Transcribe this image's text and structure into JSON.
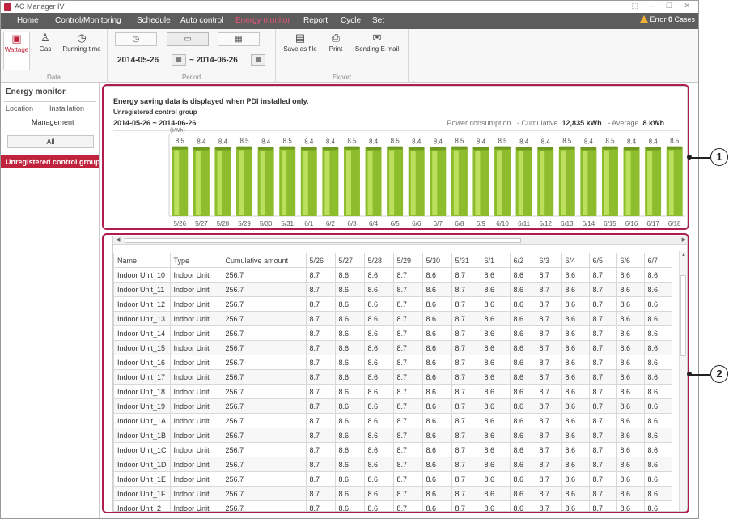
{
  "window": {
    "title": "AC Manager IV",
    "controls": "⬚ – ☐ ✕"
  },
  "menu": {
    "items": [
      "Home",
      "Control/Monitoring",
      "Schedule",
      "Auto control",
      "Energy monitor",
      "Report",
      "Cycle",
      "Set"
    ],
    "active": "Energy monitor",
    "error_prefix": "Error",
    "error_count": "0",
    "error_suffix": "Cases"
  },
  "ribbon": {
    "data_group": {
      "label": "Data",
      "buttons": [
        "Wattage",
        "Gas",
        "Running time"
      ]
    },
    "period_group": {
      "label": "Period",
      "start": "2014-05-26",
      "end": "~ 2014-06-26"
    },
    "export_group": {
      "label": "Export",
      "buttons": [
        "Save as file",
        "Print",
        "Sending E-mail"
      ]
    }
  },
  "left_panel": {
    "title": "Energy monitor",
    "tabs": [
      "Location",
      "Installation",
      "Management"
    ],
    "all_button": "All",
    "selected_group": "Unregistered control group"
  },
  "chart_panel": {
    "notice": "Energy saving data is displayed when PDI installed only.",
    "group": "Unregistered control group",
    "range": "2014-05-26 ~ 2014-06-26",
    "power_label": "Power consumption",
    "cumulative_label": "- Cumulative",
    "cumulative_value": "12,835 kWh",
    "average_label": "- Average",
    "average_value": "8 kWh"
  },
  "chart_data": {
    "type": "bar",
    "ylabel": "(kWh)",
    "categories": [
      "5/26",
      "5/27",
      "5/28",
      "5/29",
      "5/30",
      "5/31",
      "6/1",
      "6/2",
      "6/3",
      "6/4",
      "6/5",
      "6/6",
      "6/7",
      "6/8",
      "6/9",
      "6/10",
      "6/11",
      "6/12",
      "6/13",
      "6/14",
      "6/15",
      "6/16",
      "6/17",
      "6/18"
    ],
    "values": [
      8.5,
      8.4,
      8.4,
      8.5,
      8.4,
      8.5,
      8.4,
      8.4,
      8.5,
      8.4,
      8.5,
      8.4,
      8.4,
      8.5,
      8.4,
      8.5,
      8.4,
      8.4,
      8.5,
      8.4,
      8.5,
      8.4,
      8.4,
      8.5
    ],
    "ylim": [
      0,
      10
    ],
    "colors": {
      "bar_top": "#c8e86a",
      "bar_body": "#8dbd2c",
      "bar_cap": "#6e9a1e"
    }
  },
  "table": {
    "columns": [
      "Name",
      "Type",
      "Cumulative amount",
      "5/26",
      "5/27",
      "5/28",
      "5/29",
      "5/30",
      "5/31",
      "6/1",
      "6/2",
      "6/3",
      "6/4",
      "6/5",
      "6/6",
      "6/7"
    ],
    "rows": [
      [
        "Indoor Unit_10",
        "Indoor Unit",
        "256.7",
        "8.7",
        "8.6",
        "8.6",
        "8.7",
        "8.6",
        "8.7",
        "8.6",
        "8.6",
        "8.7",
        "8.6",
        "8.7",
        "8.6",
        "8.6"
      ],
      [
        "Indoor Unit_11",
        "Indoor Unit",
        "256.7",
        "8.7",
        "8.6",
        "8.6",
        "8.7",
        "8.6",
        "8.7",
        "8.6",
        "8.6",
        "8.7",
        "8.6",
        "8.7",
        "8.6",
        "8.6"
      ],
      [
        "Indoor Unit_12",
        "Indoor Unit",
        "256.7",
        "8.7",
        "8.6",
        "8.6",
        "8.7",
        "8.6",
        "8.7",
        "8.6",
        "8.6",
        "8.7",
        "8.6",
        "8.7",
        "8.6",
        "8.6"
      ],
      [
        "Indoor Unit_13",
        "Indoor Unit",
        "256.7",
        "8.7",
        "8.6",
        "8.6",
        "8.7",
        "8.6",
        "8.7",
        "8.6",
        "8.6",
        "8.7",
        "8.6",
        "8.7",
        "8.6",
        "8.6"
      ],
      [
        "Indoor Unit_14",
        "Indoor Unit",
        "256.7",
        "8.7",
        "8.6",
        "8.6",
        "8.7",
        "8.6",
        "8.7",
        "8.6",
        "8.6",
        "8.7",
        "8.6",
        "8.7",
        "8.6",
        "8.6"
      ],
      [
        "Indoor Unit_15",
        "Indoor Unit",
        "256.7",
        "8.7",
        "8.6",
        "8.6",
        "8.7",
        "8.6",
        "8.7",
        "8.6",
        "8.6",
        "8.7",
        "8.6",
        "8.7",
        "8.6",
        "8.6"
      ],
      [
        "Indoor Unit_16",
        "Indoor Unit",
        "256.7",
        "8.7",
        "8.6",
        "8.6",
        "8.7",
        "8.6",
        "8.7",
        "8.6",
        "8.6",
        "8.7",
        "8.6",
        "8.7",
        "8.6",
        "8.6"
      ],
      [
        "Indoor Unit_17",
        "Indoor Unit",
        "256.7",
        "8.7",
        "8.6",
        "8.6",
        "8.7",
        "8.6",
        "8.7",
        "8.6",
        "8.6",
        "8.7",
        "8.6",
        "8.7",
        "8.6",
        "8.6"
      ],
      [
        "Indoor Unit_18",
        "Indoor Unit",
        "256.7",
        "8.7",
        "8.6",
        "8.6",
        "8.7",
        "8.6",
        "8.7",
        "8.6",
        "8.6",
        "8.7",
        "8.6",
        "8.7",
        "8.6",
        "8.6"
      ],
      [
        "Indoor Unit_19",
        "Indoor Unit",
        "256.7",
        "8.7",
        "8.6",
        "8.6",
        "8.7",
        "8.6",
        "8.7",
        "8.6",
        "8.6",
        "8.7",
        "8.6",
        "8.7",
        "8.6",
        "8.6"
      ],
      [
        "Indoor Unit_1A",
        "Indoor Unit",
        "256.7",
        "8.7",
        "8.6",
        "8.6",
        "8.7",
        "8.6",
        "8.7",
        "8.6",
        "8.6",
        "8.7",
        "8.6",
        "8.7",
        "8.6",
        "8.6"
      ],
      [
        "Indoor Unit_1B",
        "Indoor Unit",
        "256.7",
        "8.7",
        "8.6",
        "8.6",
        "8.7",
        "8.6",
        "8.7",
        "8.6",
        "8.6",
        "8.7",
        "8.6",
        "8.7",
        "8.6",
        "8.6"
      ],
      [
        "Indoor Unit_1C",
        "Indoor Unit",
        "256.7",
        "8.7",
        "8.6",
        "8.6",
        "8.7",
        "8.6",
        "8.7",
        "8.6",
        "8.6",
        "8.7",
        "8.6",
        "8.7",
        "8.6",
        "8.6"
      ],
      [
        "Indoor Unit_1D",
        "Indoor Unit",
        "256.7",
        "8.7",
        "8.6",
        "8.6",
        "8.7",
        "8.6",
        "8.7",
        "8.6",
        "8.6",
        "8.7",
        "8.6",
        "8.7",
        "8.6",
        "8.6"
      ],
      [
        "Indoor Unit_1E",
        "Indoor Unit",
        "256.7",
        "8.7",
        "8.6",
        "8.6",
        "8.7",
        "8.6",
        "8.7",
        "8.6",
        "8.6",
        "8.7",
        "8.6",
        "8.7",
        "8.6",
        "8.6"
      ],
      [
        "Indoor Unit_1F",
        "Indoor Unit",
        "256.7",
        "8.7",
        "8.6",
        "8.6",
        "8.7",
        "8.6",
        "8.7",
        "8.6",
        "8.6",
        "8.7",
        "8.6",
        "8.7",
        "8.6",
        "8.6"
      ],
      [
        "Indoor Unit_2",
        "Indoor Unit",
        "256.7",
        "8.7",
        "8.6",
        "8.6",
        "8.7",
        "8.6",
        "8.7",
        "8.6",
        "8.6",
        "8.7",
        "8.6",
        "8.7",
        "8.6",
        "8.6"
      ]
    ]
  },
  "callouts": [
    "1",
    "2"
  ],
  "accent": "#c0243c",
  "highlight": "#b01d4a"
}
